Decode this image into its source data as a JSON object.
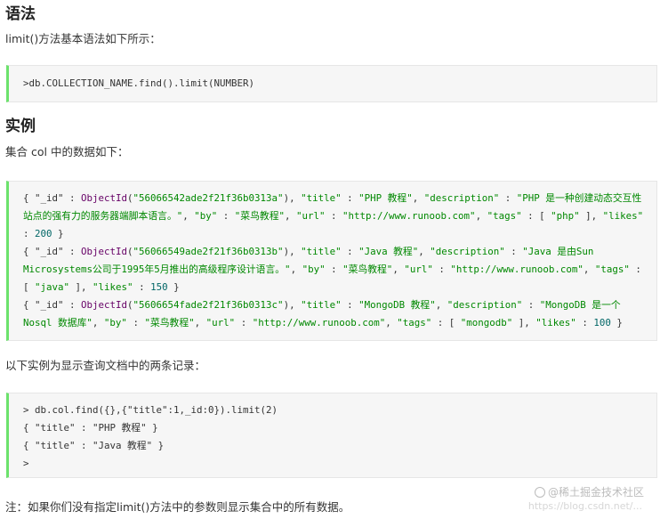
{
  "sections": {
    "syntax_heading": "语法",
    "syntax_intro": "limit()方法基本语法如下所示：",
    "syntax_code": ">db.COLLECTION_NAME.find().limit(NUMBER)",
    "example_heading": "实例",
    "example_intro": "集合 col 中的数据如下：",
    "example_records": [
      {
        "id": "56066542ade2f21f36b0313a",
        "title": "PHP 教程",
        "description": "PHP 是一种创建动态交互性站点的强有力的服务器端脚本语言。",
        "by": "菜鸟教程",
        "url": "http://www.runoob.com",
        "tags": "php",
        "likes": "200"
      },
      {
        "id": "56066549ade2f21f36b0313b",
        "title": "Java 教程",
        "description": "Java 是由Sun Microsystems公司于1995年5月推出的高级程序设计语言。",
        "by": "菜鸟教程",
        "url": "http://www.runoob.com",
        "tags": "java",
        "likes": "150"
      },
      {
        "id": "5606654fade2f21f36b0313c",
        "title": "MongoDB 教程",
        "description": "MongoDB 是一个 Nosql 数据库",
        "by": "菜鸟教程",
        "url": "http://www.runoob.com",
        "tags": "mongodb",
        "likes": "100"
      }
    ],
    "query_intro": "以下实例为显示查询文档中的两条记录：",
    "query_code": [
      "> db.col.find({},{\"title\":1,_id:0}).limit(2)",
      "{ \"title\" : \"PHP 教程\" }",
      "{ \"title\" : \"Java 教程\" }",
      ">"
    ],
    "note": "注：如果你们没有指定limit()方法中的参数则显示集合中的所有数据。"
  },
  "watermark": {
    "brand": "@稀土掘金技术社区",
    "url": "https://blog.csdn.net/..."
  },
  "colors": {
    "code_border_accent": "#6ce26c",
    "code_background": "#f6f6f6",
    "string_color": "#008800"
  }
}
